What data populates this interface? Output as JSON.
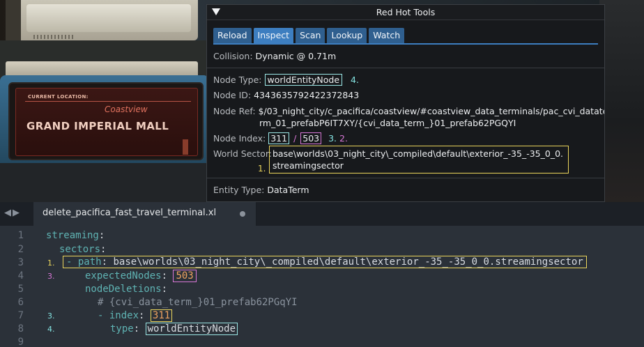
{
  "game_screen": {
    "current_location_label": "CURRENT LOCATION:",
    "district": "Coastview",
    "location_name": "GRAND IMPERIAL MALL"
  },
  "rht_window": {
    "title": "Red Hot Tools",
    "collapse_icon": "triangle-down-icon",
    "tabs": [
      {
        "label": "Reload",
        "active": false
      },
      {
        "label": "Inspect",
        "active": true
      },
      {
        "label": "Scan",
        "active": false
      },
      {
        "label": "Lookup",
        "active": false
      },
      {
        "label": "Watch",
        "active": false
      }
    ],
    "collision": {
      "label": "Collision:",
      "value": "Dynamic",
      "at": "@",
      "distance": "0.71m"
    },
    "node_type": {
      "label": "Node Type:",
      "value": "worldEntityNode",
      "annotation": "4."
    },
    "node_id": {
      "label": "Node ID:",
      "value": "4343635792422372843"
    },
    "node_ref": {
      "label": "Node Ref:",
      "line1": "$/03_night_city/c_pacifica/coastview/#coastview_data_terminals/pac_cvi_datate",
      "line2": "rm_01_prefabP6IT7XY/{cvi_data_term_}01_prefab62PGQYI"
    },
    "node_index": {
      "label": "Node Index:",
      "index": "311",
      "slash": "/",
      "count": "503",
      "annotation_cyan": "3.",
      "annotation_pink": "2."
    },
    "world_sector": {
      "label": "World Sector:",
      "line1": "base\\worlds\\03_night_city\\_compiled\\default\\exterior_-35_-35_0_0.",
      "line2": "streamingsector",
      "annotation": "1."
    },
    "entity_type": {
      "label": "Entity Type:",
      "value": "DataTerm"
    }
  },
  "editor": {
    "nav_arrows": "◀▶",
    "tab_filename": "delete_pacifica_fast_travel_terminal.xl",
    "line_numbers": [
      "1",
      "2",
      "3",
      "4",
      "5",
      "6",
      "7",
      "8",
      "9"
    ],
    "lines": {
      "l1_key": "streaming",
      "l2_key": "sectors",
      "l3_dash": "-",
      "l3_key": "path",
      "l3_value": "base\\worlds\\03_night_city\\_compiled\\default\\exterior_-35_-35_0_0.streamingsector",
      "l4_key": "expectedNodes",
      "l4_value": "503",
      "l5_key": "nodeDeletions",
      "l6_comment": "# {cvi_data_term_}01_prefab62PGqYI",
      "l7_dash": "-",
      "l7_key": "index",
      "l7_value": "311",
      "l8_key": "type",
      "l8_value": "worldEntityNode",
      "colon": ":"
    },
    "annotations": {
      "l3": "1.",
      "l4": "3.",
      "l7": "3.",
      "l8": "4."
    }
  },
  "colors": {
    "annotation_cyan": "#9be7e6",
    "annotation_pink": "#d877d6",
    "annotation_yellow": "#ecd65c",
    "tab_active": "#3d7ec0",
    "yaml_key": "#5fb3b3",
    "yaml_number": "#f0a35f"
  }
}
